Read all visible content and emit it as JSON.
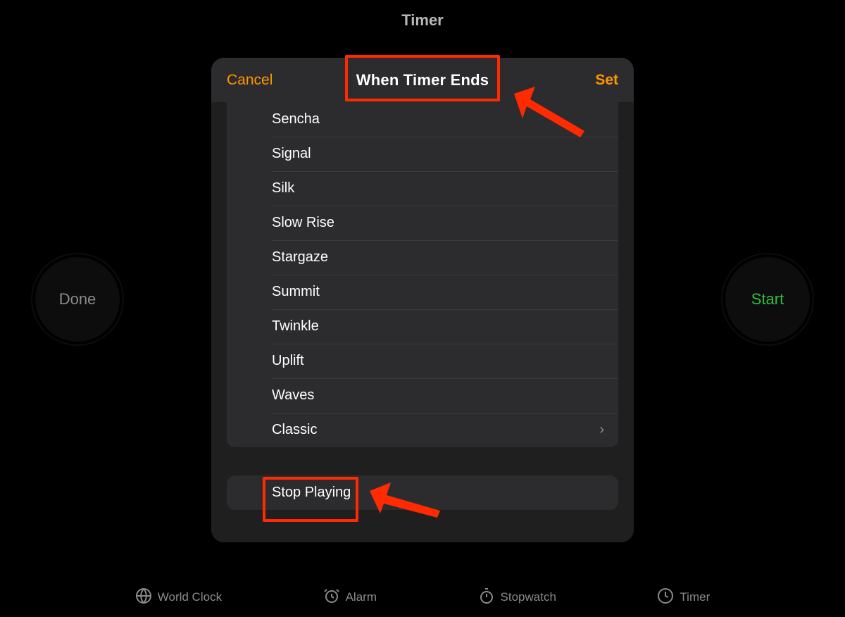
{
  "page_title": "Timer",
  "done_label": "Done",
  "start_label": "Start",
  "sheet": {
    "cancel_label": "Cancel",
    "title": "When Timer Ends",
    "set_label": "Set",
    "rows": [
      "Sencha",
      "Signal",
      "Silk",
      "Slow Rise",
      "Stargaze",
      "Summit",
      "Twinkle",
      "Uplift",
      "Waves"
    ],
    "classic_label": "Classic",
    "stop_playing_label": "Stop Playing"
  },
  "tabs": {
    "world_clock": "World Clock",
    "alarm": "Alarm",
    "stopwatch": "Stopwatch",
    "timer": "Timer"
  }
}
